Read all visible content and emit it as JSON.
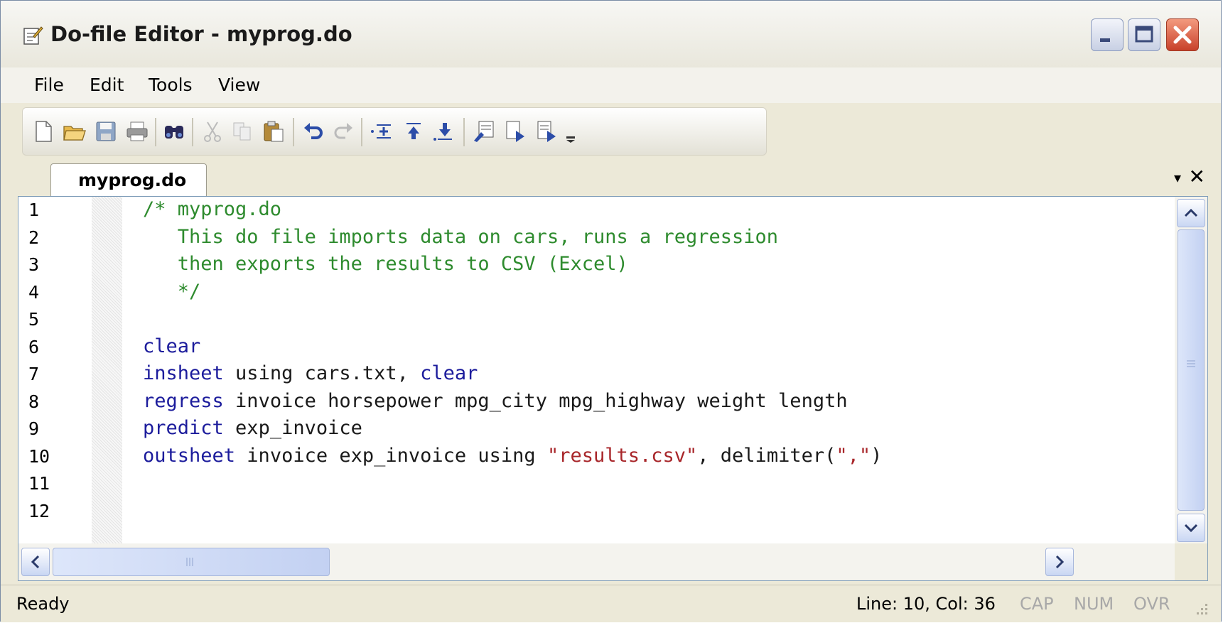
{
  "window": {
    "title": "Do-file Editor - myprog.do"
  },
  "menu": {
    "items": [
      "File",
      "Edit",
      "Tools",
      "View"
    ]
  },
  "toolbar": {
    "icons": [
      "new-file-icon",
      "open-folder-icon",
      "save-icon",
      "print-icon",
      "find-icon",
      "cut-icon",
      "copy-icon",
      "paste-icon",
      "undo-icon",
      "redo-icon",
      "indent-icon",
      "shift-up-icon",
      "shift-down-icon",
      "execute-icon",
      "run-selection-icon",
      "do-file-icon",
      "toolbar-overflow-icon"
    ]
  },
  "tabs": [
    {
      "label": "myprog.do",
      "active": true
    }
  ],
  "tab_controls": {
    "menu": "▾",
    "close": "✕"
  },
  "editor": {
    "lines": [
      {
        "n": "1",
        "segments": [
          {
            "t": "/* myprog.do",
            "c": "cmt"
          }
        ]
      },
      {
        "n": "2",
        "segments": [
          {
            "t": "   This do file imports data on cars, runs a regression",
            "c": "cmt"
          }
        ]
      },
      {
        "n": "3",
        "segments": [
          {
            "t": "   then exports the results to CSV (Excel)",
            "c": "cmt"
          }
        ]
      },
      {
        "n": "4",
        "segments": [
          {
            "t": "   */",
            "c": "cmt"
          }
        ]
      },
      {
        "n": "5",
        "segments": []
      },
      {
        "n": "6",
        "segments": [
          {
            "t": "clear",
            "c": "kw"
          }
        ]
      },
      {
        "n": "7",
        "segments": [
          {
            "t": "insheet",
            "c": "kw"
          },
          {
            "t": " using cars.txt, ",
            "c": ""
          },
          {
            "t": "clear",
            "c": "kw"
          }
        ]
      },
      {
        "n": "8",
        "segments": [
          {
            "t": "regress",
            "c": "kw"
          },
          {
            "t": " invoice horsepower mpg_city mpg_highway weight length",
            "c": ""
          }
        ]
      },
      {
        "n": "9",
        "segments": [
          {
            "t": "predict",
            "c": "kw"
          },
          {
            "t": " exp_invoice",
            "c": ""
          }
        ]
      },
      {
        "n": "10",
        "segments": [
          {
            "t": "outsheet",
            "c": "kw"
          },
          {
            "t": " invoice exp_invoice using ",
            "c": ""
          },
          {
            "t": "\"results.csv\"",
            "c": "str"
          },
          {
            "t": ", delimiter(",
            "c": ""
          },
          {
            "t": "\",\"",
            "c": "str"
          },
          {
            "t": ")",
            "c": ""
          }
        ]
      },
      {
        "n": "11",
        "segments": []
      },
      {
        "n": "12",
        "segments": []
      }
    ],
    "colors": {
      "comment": "#2E8B2E",
      "keyword": "#1C1C9C",
      "string": "#A8262A"
    }
  },
  "statusbar": {
    "status": "Ready",
    "position": "Line: 10, Col: 36",
    "indicators": [
      "CAP",
      "NUM",
      "OVR"
    ]
  }
}
